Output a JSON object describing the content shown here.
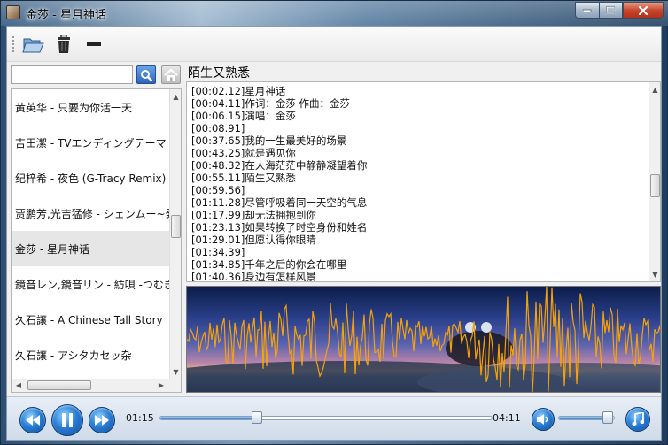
{
  "window": {
    "title": "金莎 - 星月神话"
  },
  "toolbar": {
    "icons": [
      "folder-open-icon",
      "trash-icon",
      "minus-icon"
    ]
  },
  "search": {
    "value": "",
    "placeholder": ""
  },
  "playlist": {
    "items": [
      {
        "label": "黄英华 - 只要为你活一天"
      },
      {
        "label": "吉田潔 - TVエンディングテーマ"
      },
      {
        "label": "纪梓希 - 夜色 (G-Tracy Remix)"
      },
      {
        "label": "贾鹏芳,光吉猛修 - シェンムー~発"
      },
      {
        "label": "金莎 - 星月神话",
        "selected": true
      },
      {
        "label": "鏡音レン,鏡音リン - 紡唄 -つむぎ"
      },
      {
        "label": "久石譲 - A Chinese Tall Story"
      },
      {
        "label": "久石譲 - アシタカセッ杂"
      }
    ]
  },
  "now_playing": {
    "title": "陌生又熟悉"
  },
  "lyrics": [
    "[00:02.12]星月神话",
    "[00:04.11]作词：金莎  作曲：金莎",
    "[00:06.15]演唱：金莎",
    "[00:08.91]",
    "[00:37.65]我的一生最美好的场景",
    "[00:43.25]就是遇见你",
    "[00:48.32]在人海茫茫中静静凝望着你",
    "[00:55.11]陌生又熟悉",
    "[00:59.56]",
    "[01:11.28]尽管呼吸着同一天空的气息",
    "[01:17.99]却无法拥抱到你",
    "[01:23.13]如果转换了时空身份和姓名",
    "[01:29.01]但愿认得你眼睛",
    "[01:34.39]",
    "[01:34.85]千年之后的你会在哪里",
    "[01:40.36]身边有怎样风景"
  ],
  "player": {
    "elapsed": "01:15",
    "duration": "04:11",
    "progress": 0.293,
    "volume": 0.88
  },
  "colors": {
    "accent": "#2a7ed6",
    "waveform": "#f5a20a"
  }
}
